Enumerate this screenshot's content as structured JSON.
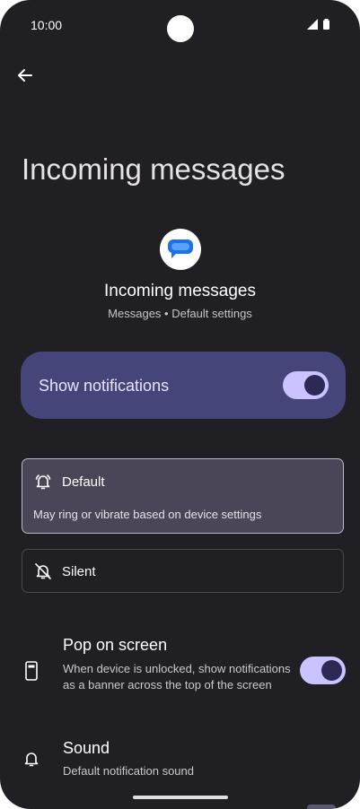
{
  "status_bar": {
    "time": "10:00"
  },
  "page": {
    "title": "Incoming messages"
  },
  "channel": {
    "name": "Incoming messages",
    "subtitle": "Messages • Default settings"
  },
  "show_notifications": {
    "label": "Show notifications",
    "enabled": true
  },
  "options": {
    "default": {
      "label": "Default",
      "description": "May ring or vibrate based on device settings",
      "selected": true
    },
    "silent": {
      "label": "Silent",
      "selected": false
    }
  },
  "pop_on_screen": {
    "title": "Pop on screen",
    "description": "When device is unlocked, show notifications as a banner across the top of the screen",
    "enabled": true
  },
  "sound": {
    "title": "Sound",
    "value": "Default notification sound"
  },
  "colors": {
    "background": "#1f1f24",
    "accent": "#c9c3ff",
    "card": "#45457a"
  },
  "icons": [
    "back-arrow-icon",
    "messages-app-icon",
    "bell-ring-icon",
    "bell-off-icon",
    "phone-popup-icon",
    "bell-icon",
    "wifi-icon",
    "signal-icon",
    "battery-icon"
  ]
}
